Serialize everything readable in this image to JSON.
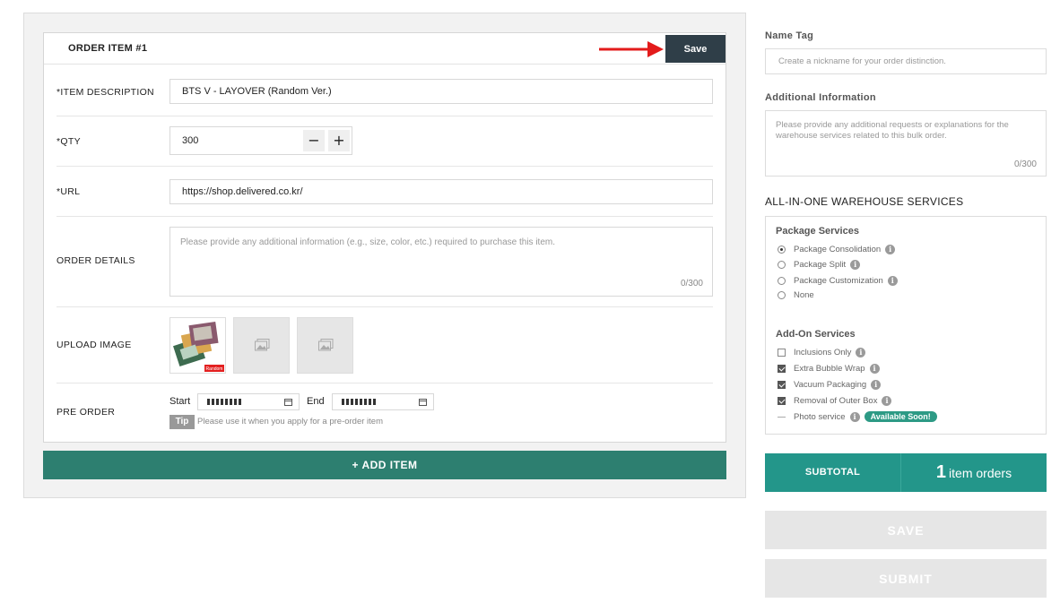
{
  "order_item": {
    "title": "ORDER ITEM #1",
    "save_label": "Save",
    "item_description": {
      "label": "*ITEM DESCRIPTION",
      "value": "BTS V - LAYOVER (Random Ver.)"
    },
    "qty": {
      "label": "*QTY",
      "value": "300",
      "minus": "−",
      "plus": "+"
    },
    "url": {
      "label": "*URL",
      "value": "https://shop.delivered.co.kr/"
    },
    "order_details": {
      "label": "ORDER DETAILS",
      "placeholder": "Please provide any additional information (e.g., size, color, etc.) required to purchase this item.",
      "counter": "0/300"
    },
    "upload_image": {
      "label": "UPLOAD IMAGE",
      "badge": "Random"
    },
    "pre_order": {
      "label": "PRE ORDER",
      "start_label": "Start",
      "end_label": "End",
      "tip": "Tip",
      "tip_text": "Please use it when you apply for a pre-order item"
    }
  },
  "add_item_label": "+ ADD ITEM",
  "sidebar": {
    "name_tag": {
      "label": "Name Tag",
      "placeholder": "Create a nickname for your order distinction."
    },
    "additional_info": {
      "label": "Additional Information",
      "placeholder": "Please provide any additional requests or explanations for the warehouse services related to this bulk order.",
      "counter": "0/300"
    },
    "services_title": "ALL-IN-ONE WAREHOUSE SERVICES",
    "package_services": {
      "title": "Package Services",
      "options": [
        {
          "label": "Package Consolidation",
          "selected": true
        },
        {
          "label": "Package Split",
          "selected": false
        },
        {
          "label": "Package Customization",
          "selected": false
        },
        {
          "label": "None",
          "selected": false
        }
      ]
    },
    "addon_services": {
      "title": "Add-On Services",
      "options": [
        {
          "label": "Inclusions Only",
          "checked": false
        },
        {
          "label": "Extra Bubble Wrap",
          "checked": true
        },
        {
          "label": "Vacuum Packaging",
          "checked": true
        },
        {
          "label": "Removal of Outer Box",
          "checked": true
        }
      ],
      "photo_service": {
        "label": "Photo service",
        "badge": "Available Soon!"
      }
    },
    "subtotal": {
      "label": "SUBTOTAL",
      "count": "1",
      "unit": "item orders"
    },
    "save_label": "SAVE",
    "submit_label": "SUBMIT"
  },
  "colors": {
    "accent": "#2d7f70",
    "subtotal": "#23968a",
    "save_dark": "#2f3e48",
    "arrow": "#e31b1b"
  }
}
